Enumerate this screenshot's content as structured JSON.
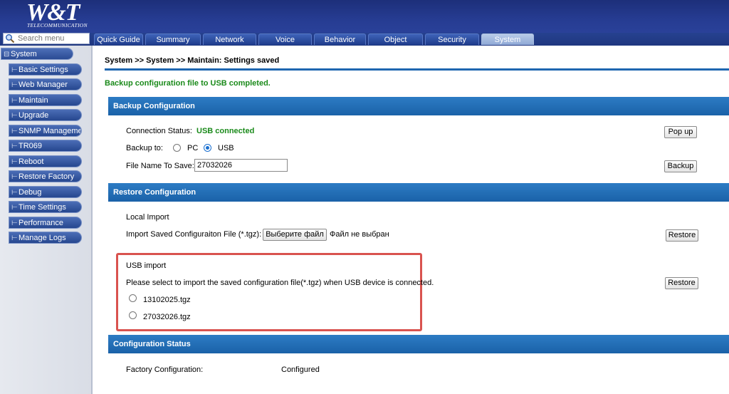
{
  "brand": {
    "logo_text": "W&T",
    "logo_sub": "TELECOMMUNICATION"
  },
  "search": {
    "placeholder": "Search menu"
  },
  "tabs": [
    {
      "label": "Quick Guide"
    },
    {
      "label": "Summary"
    },
    {
      "label": "Network"
    },
    {
      "label": "Voice"
    },
    {
      "label": "Behavior Policy"
    },
    {
      "label": "Object"
    },
    {
      "label": "Security"
    },
    {
      "label": "System"
    }
  ],
  "sidebar": {
    "root_label": "System",
    "items": [
      {
        "label": "Basic Settings"
      },
      {
        "label": "Web Manager"
      },
      {
        "label": "Maintain"
      },
      {
        "label": "Upgrade"
      },
      {
        "label": "SNMP Management"
      },
      {
        "label": "TR069"
      },
      {
        "label": "Reboot"
      },
      {
        "label": "Restore Factory"
      },
      {
        "label": "Debug"
      },
      {
        "label": "Time Settings"
      },
      {
        "label": "Performance"
      },
      {
        "label": "Manage Logs"
      }
    ]
  },
  "breadcrumb": "System >> System >>  Maintain: Settings saved",
  "success_message": "Backup configuration file to USB completed.",
  "backup": {
    "title": "Backup Configuration",
    "connection_label": "Connection Status:",
    "connection_value": "USB connected",
    "popup_button": "Pop up",
    "backup_to_label": "Backup to:",
    "option_pc": "PC",
    "option_usb": "USB",
    "filename_label": "File Name To Save:",
    "filename_value": "27032026",
    "backup_button": "Backup"
  },
  "restore": {
    "title": "Restore Configuration",
    "local_import_label": "Local Import",
    "import_file_label": "Import Saved Configuraiton File (*.tgz):",
    "choose_file_button": "Выберите файл",
    "no_file_text": "Файл не выбран",
    "restore_button": "Restore",
    "usb_import_label": "USB import",
    "usb_instruction": "Please select to import the saved configuration file(*.tgz) when USB device is connected.",
    "usb_files": [
      {
        "name": "13102025.tgz"
      },
      {
        "name": "27032026.tgz"
      }
    ],
    "usb_restore_button": "Restore"
  },
  "status": {
    "title": "Configuration Status",
    "factory_label": "Factory Configuration:",
    "factory_value": "Configured"
  },
  "colors": {
    "header_bg": "#263c92",
    "section_head": "#2d7cc4",
    "success_green": "#1a8a1a",
    "highlight_red": "#d9534f"
  }
}
